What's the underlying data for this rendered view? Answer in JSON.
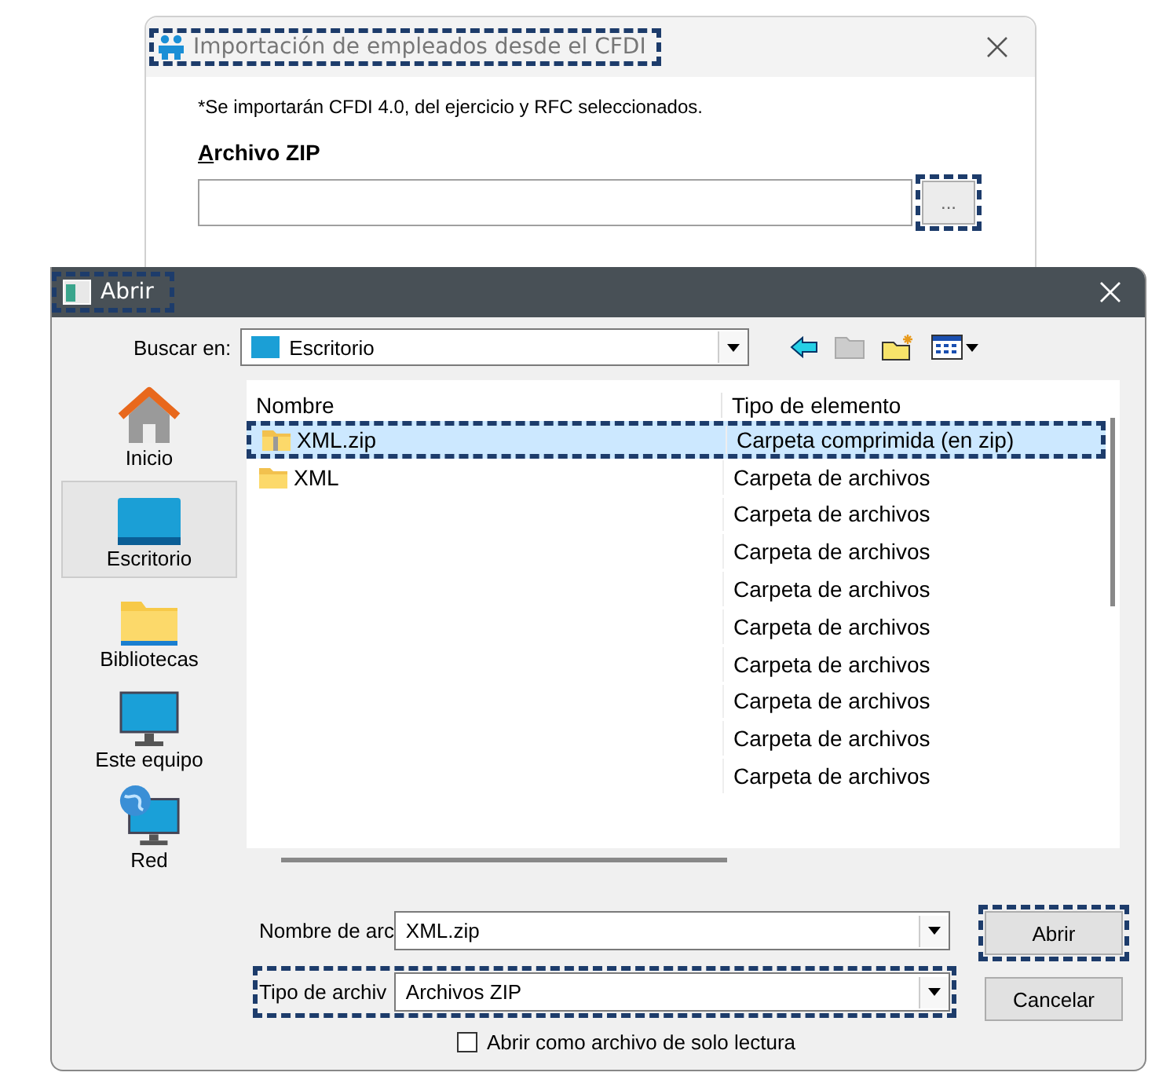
{
  "import_dialog": {
    "title": "Importación de empleados desde el CFDI",
    "title_highlighted": true,
    "note": "*Se importarán CFDI 4.0, del ejercicio y RFC seleccionados.",
    "zip_label": "Archivo ZIP",
    "browse_button": {
      "label": "...",
      "highlighted": true
    }
  },
  "open_dialog": {
    "title": "Abrir",
    "title_highlighted": true,
    "look_in": {
      "label": "Buscar en:",
      "value": "Escritorio"
    },
    "places": [
      {
        "label": "Inicio",
        "kind": "home",
        "selected": false
      },
      {
        "label": "Escritorio",
        "kind": "desktop",
        "selected": true
      },
      {
        "label": "Bibliotecas",
        "kind": "libraries",
        "selected": false
      },
      {
        "label": "Este equipo",
        "kind": "computer",
        "selected": false
      },
      {
        "label": "Red",
        "kind": "network",
        "selected": false
      }
    ],
    "columns": [
      "Nombre",
      "Tipo de elemento"
    ],
    "files": [
      {
        "name": "XML.zip",
        "type": "Carpeta comprimida (en zip)",
        "kind": "zip",
        "selected": true,
        "highlighted": true
      },
      {
        "name": "XML",
        "type": "Carpeta de archivos",
        "kind": "folder",
        "selected": false,
        "highlighted": false
      },
      {
        "type": "Carpeta de archivos",
        "selected": false,
        "highlighted": false
      },
      {
        "type": "Carpeta de archivos",
        "selected": false,
        "highlighted": false
      },
      {
        "type": "Carpeta de archivos",
        "selected": false,
        "highlighted": false
      },
      {
        "type": "Carpeta de archivos",
        "selected": false,
        "highlighted": false
      },
      {
        "type": "Carpeta de archivos",
        "selected": false,
        "highlighted": false
      },
      {
        "type": "Carpeta de archivos",
        "selected": false,
        "highlighted": false
      },
      {
        "type": "Carpeta de archivos",
        "selected": false,
        "highlighted": false
      },
      {
        "type": "Carpeta de archivos",
        "selected": false,
        "highlighted": false
      }
    ],
    "file_name": {
      "label": "Nombre de arc",
      "value": "XML.zip",
      "highlighted": false
    },
    "file_type": {
      "label": "Tipo de archiv",
      "value": "Archivos ZIP",
      "highlighted": true
    },
    "buttons": [
      {
        "label": "Abrir",
        "highlighted": true
      },
      {
        "label": "Cancelar",
        "highlighted": false
      }
    ],
    "read_only": {
      "label": "Abrir como archivo de solo lectura",
      "checked": false
    }
  }
}
